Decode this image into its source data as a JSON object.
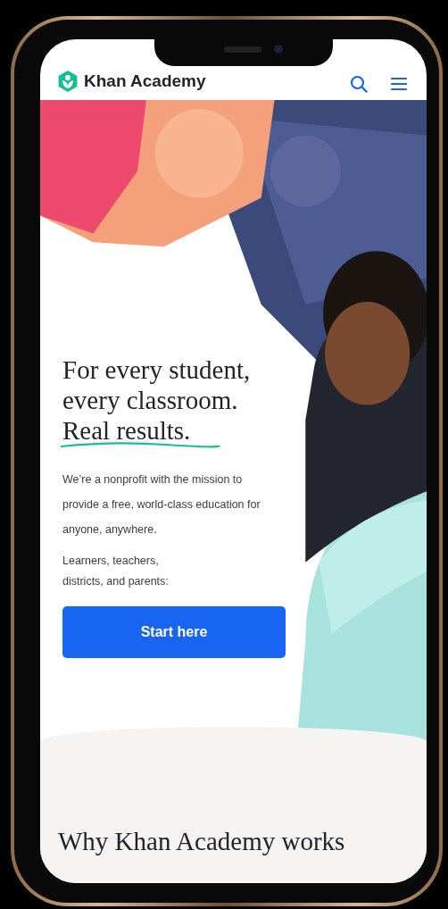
{
  "header": {
    "logo": "Khan Academy"
  },
  "hero": {
    "heading": [
      "For every student,",
      "every classroom."
    ],
    "highlight": "Real results.",
    "body": "We’re a nonprofit with the mission to provide a free, world-class education for anyone, anywhere.",
    "audience": "Learners, teachers, districts, and parents:",
    "button": "Start here"
  },
  "section": {
    "heading": "Why Khan Academy works"
  }
}
